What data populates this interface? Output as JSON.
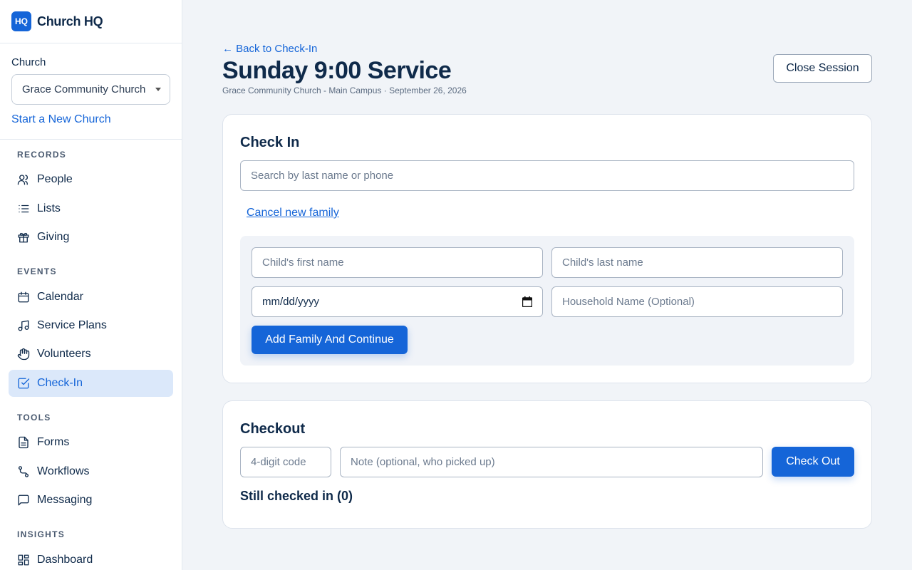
{
  "brand": {
    "logo_text": "HQ",
    "name": "Church HQ"
  },
  "church": {
    "label": "Church",
    "selected": "Grace Community Church - Main Campus",
    "new_link": "Start a New Church"
  },
  "nav": {
    "records": {
      "title": "RECORDS",
      "items": [
        {
          "label": "People",
          "icon": "people-icon"
        },
        {
          "label": "Lists",
          "icon": "list-icon"
        },
        {
          "label": "Giving",
          "icon": "gift-icon"
        }
      ]
    },
    "events": {
      "title": "EVENTS",
      "items": [
        {
          "label": "Calendar",
          "icon": "calendar-icon"
        },
        {
          "label": "Service Plans",
          "icon": "music-icon"
        },
        {
          "label": "Volunteers",
          "icon": "hand-icon"
        },
        {
          "label": "Check-In",
          "icon": "check-square-icon",
          "active": true
        }
      ]
    },
    "tools": {
      "title": "TOOLS",
      "items": [
        {
          "label": "Forms",
          "icon": "file-icon"
        },
        {
          "label": "Workflows",
          "icon": "workflow-icon"
        },
        {
          "label": "Messaging",
          "icon": "message-icon"
        }
      ]
    },
    "insights": {
      "title": "INSIGHTS",
      "items": [
        {
          "label": "Dashboard",
          "icon": "dashboard-icon"
        }
      ]
    }
  },
  "header": {
    "back_link": "← Back to Check-In",
    "title": "Sunday 9:00 Service",
    "subtitle": "Grace Community Church - Main Campus · September 26, 2026",
    "close_button": "Close Session"
  },
  "checkin": {
    "title": "Check In",
    "search_placeholder": "Search by last name or phone",
    "cancel_link": "Cancel new family",
    "first_name_placeholder": "Child's first name",
    "last_name_placeholder": "Child's last name",
    "birthdate_value": "mm/dd/yyyy",
    "household_placeholder": "Household Name (Optional)",
    "submit_button": "Add Family And Continue"
  },
  "checkout": {
    "title": "Checkout",
    "code_placeholder": "4-digit code",
    "note_placeholder": "Note (optional, who picked up)",
    "button": "Check Out",
    "still_checked_in": "Still checked in (0)"
  },
  "colors": {
    "accent": "#1565d8",
    "active_bg": "#dbe8fa",
    "text": "#0f2a4a",
    "page_bg": "#f1f4f8"
  }
}
